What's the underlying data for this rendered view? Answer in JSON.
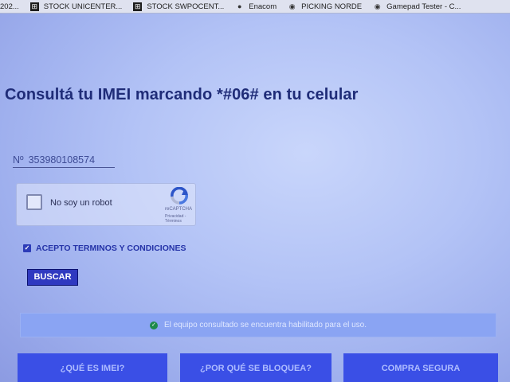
{
  "bookmarks": [
    {
      "label": "202...",
      "icon": "none"
    },
    {
      "label": "STOCK UNICENTER...",
      "icon": "sheet-icon"
    },
    {
      "label": "STOCK SWPOCENT...",
      "icon": "sheet-icon"
    },
    {
      "label": "Enacom",
      "icon": "site-icon"
    },
    {
      "label": "PICKING NORDE",
      "icon": "site-icon"
    },
    {
      "label": "Gamepad Tester - C...",
      "icon": "site-icon"
    }
  ],
  "page": {
    "title": "Consultá tu IMEI marcando *#06# en tu celular",
    "imei_prefix": "Nº",
    "imei_value": "353980108574"
  },
  "captcha": {
    "label": "No soy un robot",
    "brand": "reCAPTCHA",
    "links": "Privacidad - Términos"
  },
  "terms": {
    "label": "ACEPTO TERMINOS Y CONDICIONES",
    "checked": true
  },
  "search": {
    "button_label": "BUSCAR"
  },
  "result": {
    "message": "El equipo consultado se encuentra habilitado para el uso.",
    "status_color": "#1e8a4c"
  },
  "bottom_tabs": [
    {
      "label": "¿QUÉ ES IMEI?"
    },
    {
      "label": "¿POR QUÉ SE BLOQUEA?"
    },
    {
      "label": "COMPRA SEGURA"
    }
  ],
  "colors": {
    "accent": "#2f39c0",
    "title": "#1f2c78",
    "tab_bg": "#3a4fe6"
  }
}
